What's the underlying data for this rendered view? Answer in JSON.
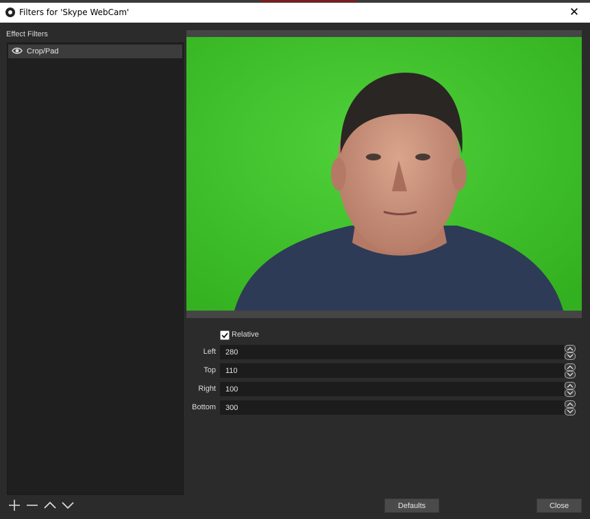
{
  "window": {
    "title": "Filters for 'Skype WebCam'",
    "app_icon": "obs-logo-icon",
    "close_icon": "close-icon"
  },
  "left_panel": {
    "label": "Effect Filters",
    "filters": [
      {
        "name": "Crop/Pad",
        "visible_icon": "eye-icon",
        "selected": true
      }
    ],
    "buttons": [
      {
        "icon": "plus-icon",
        "action": "add"
      },
      {
        "icon": "minus-icon",
        "action": "remove"
      },
      {
        "icon": "chevron-up-icon",
        "action": "move-up"
      },
      {
        "icon": "chevron-down-icon",
        "action": "move-down"
      }
    ]
  },
  "preview": {
    "description_icon": "webcam-preview-image",
    "background_color": "#3fc42a"
  },
  "properties": {
    "relative": {
      "label": "Relative",
      "checked": true
    },
    "fields": [
      {
        "label": "Left",
        "value": "280"
      },
      {
        "label": "Top",
        "value": "110"
      },
      {
        "label": "Right",
        "value": "100"
      },
      {
        "label": "Bottom",
        "value": "300"
      }
    ]
  },
  "footer": {
    "defaults_label": "Defaults",
    "close_label": "Close"
  }
}
